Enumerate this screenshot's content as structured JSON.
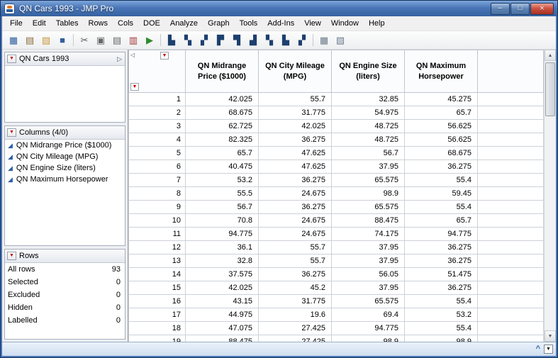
{
  "window": {
    "title": "QN Cars 1993 - JMP Pro"
  },
  "icons": {
    "minimize": "–",
    "maximize": "□",
    "close": "×",
    "red_triangle": "▼",
    "panel_expand": "▷",
    "collapse_left": "◁",
    "continuous_column": "◢",
    "scroll_up": "▲",
    "scroll_down": "▼",
    "chevron_up": "^",
    "status_dropdown": "▼"
  },
  "colors": {
    "titlebar_blue": "#4a76b8",
    "red_triangle": "#cc0000",
    "continuous_icon_blue": "#2a5fa8",
    "platform_icon_navy": "#1c3f6e"
  },
  "menu": {
    "items": [
      "File",
      "Edit",
      "Tables",
      "Rows",
      "Cols",
      "DOE",
      "Analyze",
      "Graph",
      "Tools",
      "Add-Ins",
      "View",
      "Window",
      "Help"
    ]
  },
  "toolbar": {
    "items": [
      {
        "name": "new-data-table-icon",
        "glyph": "▦",
        "color": "#2c5d9e"
      },
      {
        "name": "new-journal-icon",
        "glyph": "▤",
        "color": "#8a6d3b"
      },
      {
        "name": "open-icon",
        "glyph": "▨",
        "color": "#c9973a"
      },
      {
        "name": "save-icon",
        "glyph": "■",
        "color": "#335f9b"
      },
      {
        "separator": true
      },
      {
        "name": "cut-icon",
        "glyph": "✂",
        "color": "#555555"
      },
      {
        "name": "copy-icon",
        "glyph": "▣",
        "color": "#666666"
      },
      {
        "name": "paste-icon",
        "glyph": "▤",
        "color": "#666666"
      },
      {
        "name": "clear-icon",
        "glyph": "▥",
        "color": "#a33333"
      },
      {
        "name": "run-script-icon",
        "glyph": "▶",
        "color": "#2e8b2e"
      },
      {
        "separator": true
      },
      {
        "name": "distribution-icon",
        "glyph": "▙",
        "color": "#1c3f6e"
      },
      {
        "name": "fit-y-by-x-icon",
        "glyph": "▚",
        "color": "#1c3f6e"
      },
      {
        "name": "matched-pairs-icon",
        "glyph": "▞",
        "color": "#1c3f6e"
      },
      {
        "name": "fit-model-icon",
        "glyph": "▛",
        "color": "#1c3f6e"
      },
      {
        "name": "tabulate-icon",
        "glyph": "▜",
        "color": "#1c3f6e"
      },
      {
        "name": "multivariate-icon",
        "glyph": "▟",
        "color": "#1c3f6e"
      },
      {
        "name": "quality-control-icon",
        "glyph": "▚",
        "color": "#1c3f6e"
      },
      {
        "name": "reliability-icon",
        "glyph": "▙",
        "color": "#1c3f6e"
      },
      {
        "name": "doe-platform-icon",
        "glyph": "▞",
        "color": "#1c3f6e"
      },
      {
        "separator": true
      },
      {
        "name": "window-layout-icon",
        "glyph": "▦",
        "color": "#6b7b8c"
      },
      {
        "name": "journal-layout-icon",
        "glyph": "▧",
        "color": "#6b7b8c"
      }
    ]
  },
  "sidebar": {
    "table_panel": {
      "title": "QN Cars 1993"
    },
    "columns_panel": {
      "title": "Columns (4/0)",
      "items": [
        "QN Midrange Price ($1000)",
        "QN City Mileage (MPG)",
        "QN Engine Size (liters)",
        "QN Maximum Horsepower"
      ]
    },
    "rows_panel": {
      "title": "Rows",
      "stats": [
        {
          "label": "All rows",
          "value": "93"
        },
        {
          "label": "Selected",
          "value": "0"
        },
        {
          "label": "Excluded",
          "value": "0"
        },
        {
          "label": "Hidden",
          "value": "0"
        },
        {
          "label": "Labelled",
          "value": "0"
        }
      ]
    }
  },
  "table": {
    "columns": [
      "QN Midrange\nPrice ($1000)",
      "QN City Mileage\n(MPG)",
      "QN Engine Size\n(liters)",
      "QN Maximum\nHorsepower"
    ],
    "rows": [
      {
        "n": "1",
        "v": [
          "42.025",
          "55.7",
          "32.85",
          "45.275"
        ]
      },
      {
        "n": "2",
        "v": [
          "68.675",
          "31.775",
          "54.975",
          "65.7"
        ]
      },
      {
        "n": "3",
        "v": [
          "62.725",
          "42.025",
          "48.725",
          "56.625"
        ]
      },
      {
        "n": "4",
        "v": [
          "82.325",
          "36.275",
          "48.725",
          "56.625"
        ]
      },
      {
        "n": "5",
        "v": [
          "65.7",
          "47.625",
          "56.7",
          "68.675"
        ]
      },
      {
        "n": "6",
        "v": [
          "40.475",
          "47.625",
          "37.95",
          "36.275"
        ]
      },
      {
        "n": "7",
        "v": [
          "53.2",
          "36.275",
          "65.575",
          "55.4"
        ]
      },
      {
        "n": "8",
        "v": [
          "55.5",
          "24.675",
          "98.9",
          "59.45"
        ]
      },
      {
        "n": "9",
        "v": [
          "56.7",
          "36.275",
          "65.575",
          "55.4"
        ]
      },
      {
        "n": "10",
        "v": [
          "70.8",
          "24.675",
          "88.475",
          "65.7"
        ]
      },
      {
        "n": "11",
        "v": [
          "94.775",
          "24.675",
          "74.175",
          "94.775"
        ]
      },
      {
        "n": "12",
        "v": [
          "36.1",
          "55.7",
          "37.95",
          "36.275"
        ]
      },
      {
        "n": "13",
        "v": [
          "32.8",
          "55.7",
          "37.95",
          "36.275"
        ]
      },
      {
        "n": "14",
        "v": [
          "37.575",
          "36.275",
          "56.05",
          "51.475"
        ]
      },
      {
        "n": "15",
        "v": [
          "42.025",
          "45.2",
          "37.95",
          "36.275"
        ]
      },
      {
        "n": "16",
        "v": [
          "43.15",
          "31.775",
          "65.575",
          "55.4"
        ]
      },
      {
        "n": "17",
        "v": [
          "44.975",
          "19.6",
          "69.4",
          "53.2"
        ]
      },
      {
        "n": "18",
        "v": [
          "47.075",
          "27.425",
          "94.775",
          "55.4"
        ]
      },
      {
        "n": "19",
        "v": [
          "88.475",
          "27.425",
          "98.9",
          "98.9"
        ]
      }
    ]
  }
}
